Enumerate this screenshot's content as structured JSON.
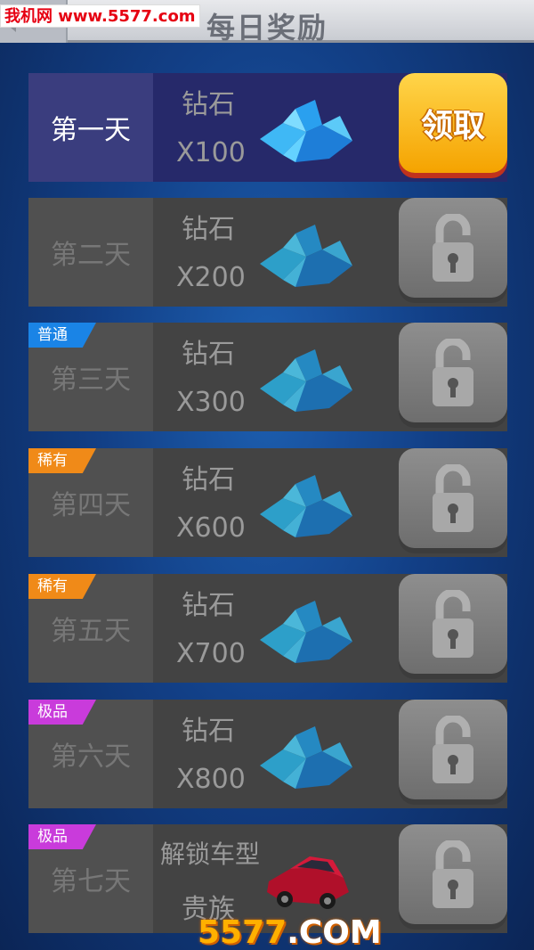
{
  "header": {
    "title": "每日奖励",
    "back_icon": "back-arrow-icon",
    "watermark": "我机网 www.5577.com"
  },
  "colors": {
    "tag_common": "#1a84e6",
    "tag_rare": "#f08a18",
    "tag_epic": "#c93bdb",
    "claim_button": "#f5b400",
    "active_row": "#26296a"
  },
  "rewards": [
    {
      "day": "第一天",
      "item": "钻石",
      "amount": "X100",
      "icon": "diamond-icon",
      "button": "领取",
      "state": "claimable"
    },
    {
      "day": "第二天",
      "item": "钻石",
      "amount": "X200",
      "icon": "diamond-icon",
      "state": "locked"
    },
    {
      "day": "第三天",
      "item": "钻石",
      "amount": "X300",
      "icon": "diamond-icon",
      "tag": "普通",
      "state": "locked"
    },
    {
      "day": "第四天",
      "item": "钻石",
      "amount": "X600",
      "icon": "diamond-icon",
      "tag": "稀有",
      "state": "locked"
    },
    {
      "day": "第五天",
      "item": "钻石",
      "amount": "X700",
      "icon": "diamond-icon",
      "tag": "稀有",
      "state": "locked"
    },
    {
      "day": "第六天",
      "item": "钻石",
      "amount": "X800",
      "icon": "diamond-icon",
      "tag": "极品",
      "state": "locked"
    },
    {
      "day": "第七天",
      "item": "解锁车型",
      "amount": "贵族",
      "icon": "red-car-icon",
      "tag": "极品",
      "state": "locked"
    }
  ],
  "footer_watermark": {
    "part1": "5577",
    "part2": ".COM"
  }
}
